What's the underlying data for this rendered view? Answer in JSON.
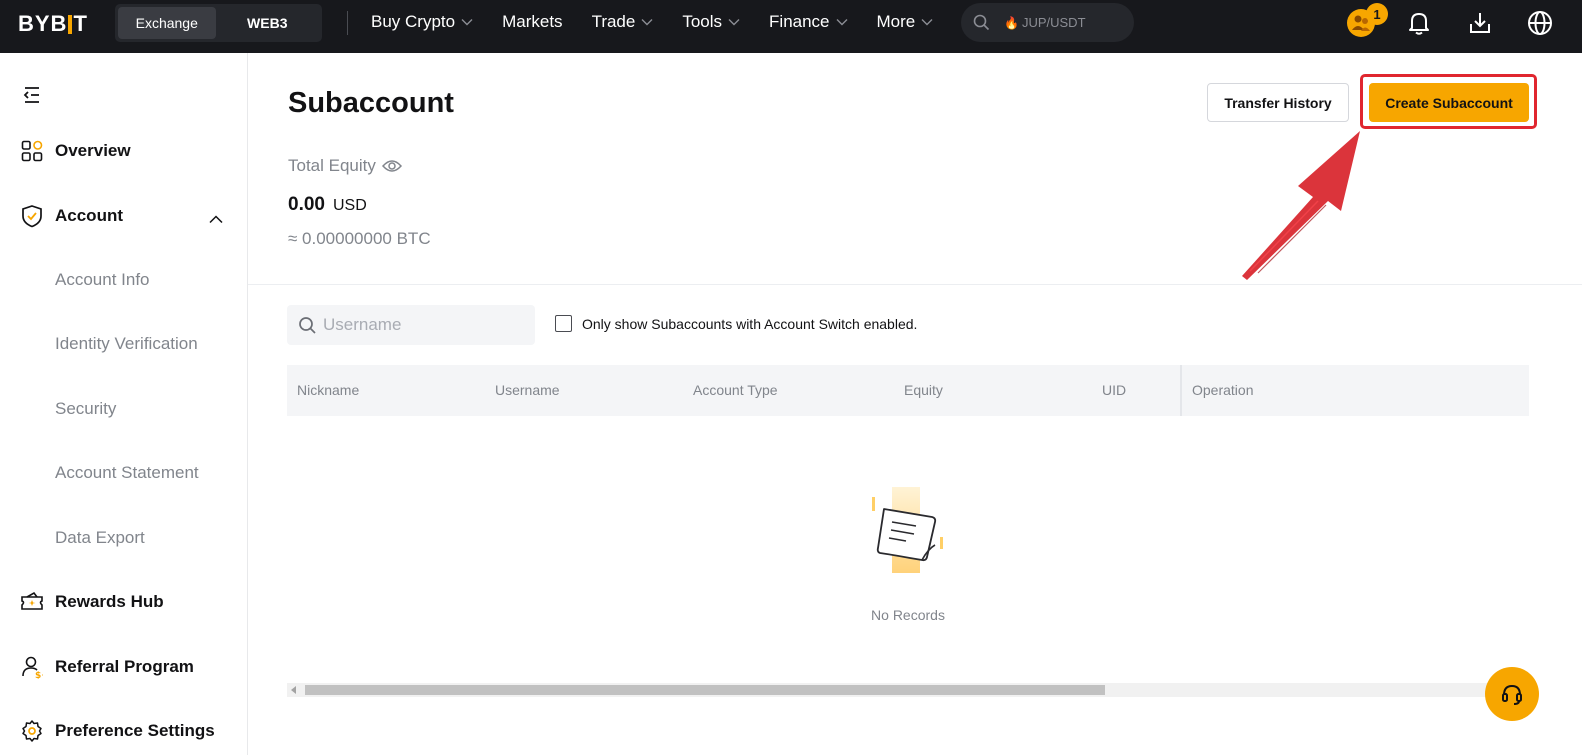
{
  "topbar": {
    "logo_text": "BYBIT",
    "switcher": {
      "exchange": "Exchange",
      "web3": "WEB3"
    },
    "nav": [
      "Buy Crypto",
      "Markets",
      "Trade",
      "Tools",
      "Finance",
      "More"
    ],
    "search_placeholder": "JUP/USDT",
    "notification_count": "1",
    "icons": [
      "search-icon",
      "fire-icon",
      "user-rewards-icon",
      "bell-icon",
      "download-icon",
      "globe-icon"
    ]
  },
  "sidebar": {
    "overview": "Overview",
    "account": "Account",
    "account_sub": [
      "Account Info",
      "Identity Verification",
      "Security",
      "Account Statement",
      "Data Export"
    ],
    "rewards": "Rewards Hub",
    "referral": "Referral Program",
    "preferences": "Preference Settings"
  },
  "main": {
    "title": "Subaccount",
    "transfer_history": "Transfer History",
    "create_subaccount": "Create Subaccount",
    "total_equity_label": "Total Equity",
    "equity_value": "0.00",
    "equity_unit": "USD",
    "equity_btc": "≈ 0.00000000 BTC",
    "username_placeholder": "Username",
    "switch_filter_label": "Only show Subaccounts with Account Switch enabled.",
    "columns": [
      "Nickname",
      "Username",
      "Account Type",
      "Equity",
      "UID",
      "Operation"
    ],
    "empty_text": "No Records"
  },
  "colors": {
    "brand": "#f7a600",
    "topbar_bg": "#17181c",
    "annotation_red": "#e0262f"
  }
}
